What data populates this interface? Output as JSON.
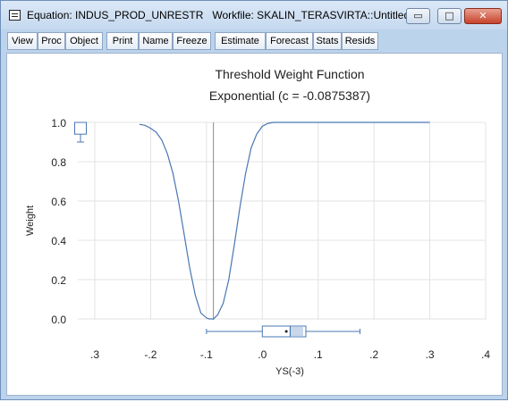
{
  "window": {
    "title": "Equation: INDUS_PROD_UNRESTR   Workfile: SKALIN_TERASVIRTA::Untitled\\",
    "controls": {
      "minimize": "▭",
      "maximize": "□",
      "close": "✕"
    }
  },
  "toolbar": {
    "buttons": [
      "View",
      "Proc",
      "Object",
      "Print",
      "Name",
      "Freeze",
      "Estimate",
      "Forecast",
      "Stats",
      "Resids"
    ]
  },
  "chart_data": {
    "type": "line",
    "title": "Threshold Weight Function",
    "subtitle": "Exponential (c = -0.0875387)",
    "xlabel": "YS(-3)",
    "ylabel": "Weight",
    "x_ticks": [
      -0.3,
      -0.2,
      -0.1,
      0.0,
      0.1,
      0.2,
      0.3,
      0.4
    ],
    "x_tick_labels": [
      ".3",
      "-.2",
      "-.1",
      ".0",
      ".1",
      ".2",
      ".3",
      ".4"
    ],
    "y_ticks": [
      0.0,
      0.2,
      0.4,
      0.6,
      0.8,
      1.0
    ],
    "y_tick_labels": [
      "0.0",
      "0.2",
      "0.4",
      "0.6",
      "0.8",
      "1.0"
    ],
    "xlim": [
      -0.35,
      0.4
    ],
    "ylim": [
      -0.02,
      1.02
    ],
    "grid": true,
    "threshold_c": -0.0875387,
    "series": [
      {
        "x": [
          -0.22,
          -0.21,
          -0.2,
          -0.19,
          -0.18,
          -0.17,
          -0.16,
          -0.15,
          -0.14,
          -0.13,
          -0.12,
          -0.11,
          -0.1,
          -0.095,
          -0.0875,
          -0.08,
          -0.07,
          -0.06,
          -0.05,
          -0.04,
          -0.03,
          -0.02,
          -0.01,
          0.0,
          0.01,
          0.02,
          0.03,
          0.05,
          0.1,
          0.2,
          0.3
        ],
        "y": [
          0.99,
          0.985,
          0.97,
          0.95,
          0.91,
          0.84,
          0.74,
          0.6,
          0.43,
          0.26,
          0.12,
          0.03,
          0.005,
          0.0,
          0.0,
          0.02,
          0.08,
          0.2,
          0.38,
          0.57,
          0.74,
          0.87,
          0.94,
          0.98,
          0.995,
          1.0,
          1.0,
          1.0,
          1.0,
          1.0,
          1.0
        ]
      }
    ],
    "y_boxplot": {
      "whisker_low": 0.9,
      "q1": 0.94,
      "median": 0.985,
      "q3": 1.0,
      "whisker_high": 1.0
    },
    "x_boxplot": {
      "whisker_low": -0.1,
      "q1": 0.0,
      "median": 0.05,
      "mean": 0.043,
      "q3": 0.078,
      "whisker_high": 0.175
    }
  }
}
